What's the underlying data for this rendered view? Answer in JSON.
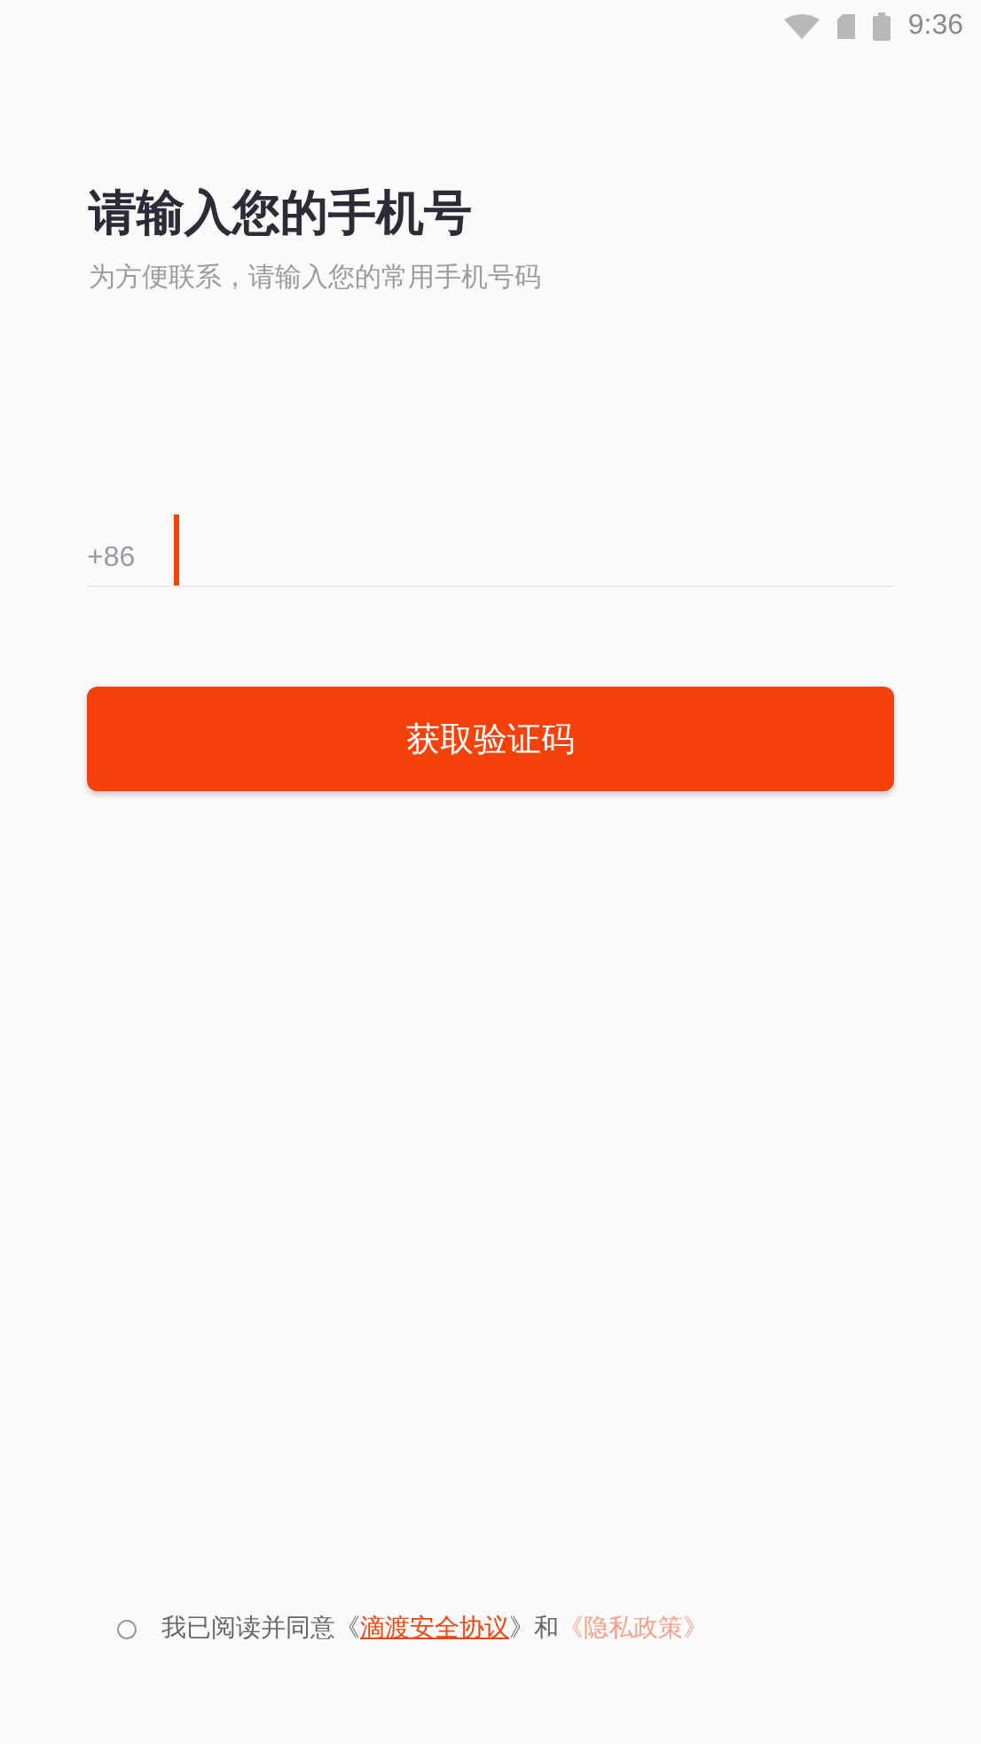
{
  "status_bar": {
    "time": "9:36"
  },
  "title": "请输入您的手机号",
  "subtitle": "为方便联系，请输入您的常用手机号码",
  "phone": {
    "prefix": "+86",
    "focused": true
  },
  "submit": {
    "label": "获取验证码"
  },
  "agreement": {
    "checked": false,
    "parts": [
      {
        "kind": "text",
        "text": "我已阅读并同意《"
      },
      {
        "kind": "link",
        "text": "滴渡安全协议"
      },
      {
        "kind": "text",
        "text": "》和"
      },
      {
        "kind": "link2",
        "text": "《隐私政策》"
      }
    ]
  }
}
